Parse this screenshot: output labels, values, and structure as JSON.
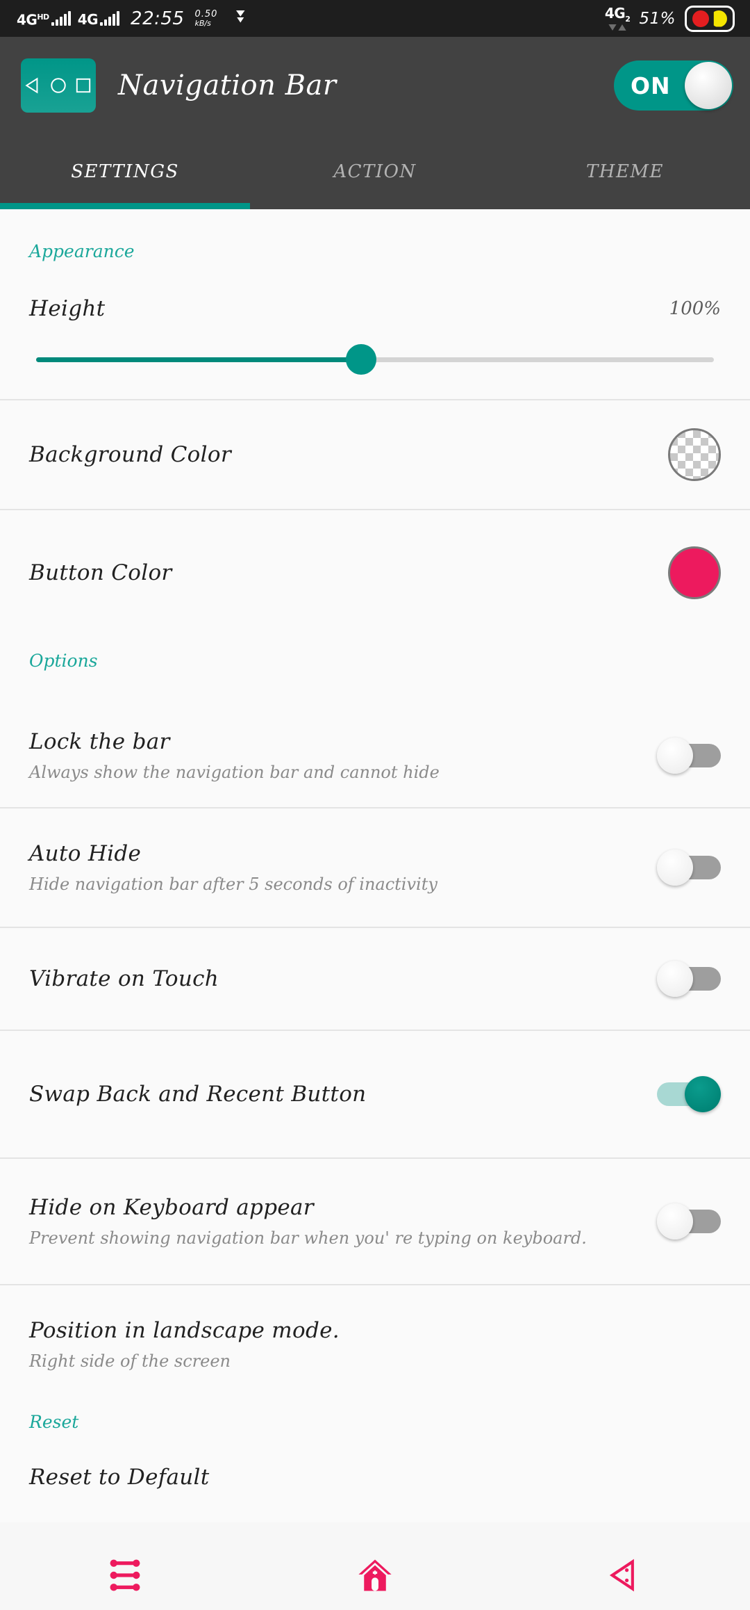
{
  "statusbar": {
    "network_1": "4G",
    "network_1_sup": "HD",
    "network_2": "4G",
    "clock": "22:55",
    "speed_value": "0.50",
    "speed_unit": "kB/s",
    "play_icon": "double-chevron-down-icon",
    "network_right": "4G",
    "network_right_sub": "2",
    "battery_percent": "51%",
    "battery_icon": "battery-icon"
  },
  "appbar": {
    "app_icon": "navigation-bar-app-icon",
    "title": "Navigation Bar",
    "master_toggle_label": "ON",
    "master_toggle_state": "on"
  },
  "tabs": [
    {
      "label": "SETTINGS",
      "active": true
    },
    {
      "label": "ACTION",
      "active": false
    },
    {
      "label": "THEME",
      "active": false
    }
  ],
  "appearance": {
    "header": "Appearance",
    "height": {
      "label": "Height",
      "value": "100%",
      "slider_percent": 47
    },
    "background_color": {
      "label": "Background Color",
      "swatch": "transparent-checkerboard"
    },
    "button_color": {
      "label": "Button Color",
      "swatch": "#ED1A5E"
    }
  },
  "options": {
    "header": "Options",
    "items": [
      {
        "title": "Lock the bar",
        "subtitle": "Always show the navigation bar and cannot hide",
        "state": "off"
      },
      {
        "title": "Auto Hide",
        "subtitle": "Hide navigation bar after 5 seconds of inactivity",
        "state": "off"
      },
      {
        "title": "Vibrate on Touch",
        "subtitle": "",
        "state": "off"
      },
      {
        "title": "Swap Back and Recent Button",
        "subtitle": "",
        "state": "on"
      },
      {
        "title": "Hide on Keyboard appear",
        "subtitle": "Prevent showing navigation bar when you' re typing on keyboard.",
        "state": "off"
      },
      {
        "title": "Position in landscape mode.",
        "subtitle": "Right side of the screen",
        "state": "none"
      }
    ]
  },
  "reset": {
    "header": "Reset",
    "label": "Reset to Default"
  },
  "navbar": {
    "color": "#ED1A5E",
    "buttons": [
      {
        "name": "recents-icon"
      },
      {
        "name": "home-icon"
      },
      {
        "name": "back-icon"
      }
    ]
  },
  "colors": {
    "accent": "#009688",
    "section_header": "#1aa79a",
    "appbar_bg": "#424242",
    "statusbar_bg": "#1e1e1e",
    "pink": "#ED1A5E"
  }
}
